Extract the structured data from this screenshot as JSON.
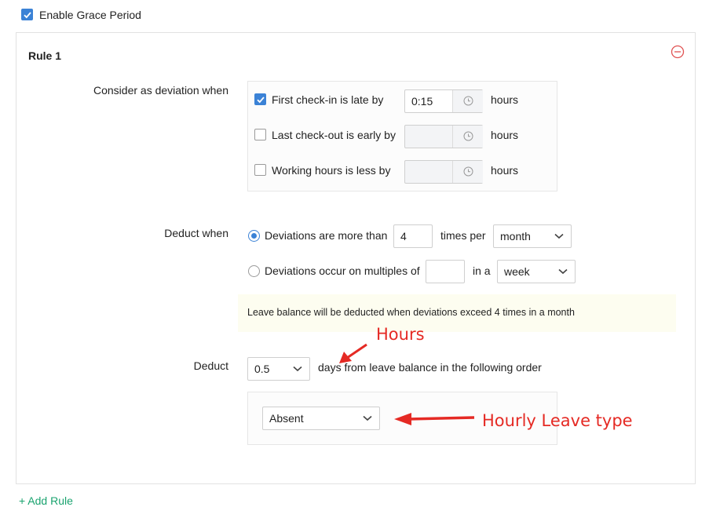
{
  "grace_period": {
    "label": "Enable Grace Period",
    "checked": true
  },
  "rule": {
    "title": "Rule 1",
    "deviation_label": "Consider as deviation when",
    "conditions": [
      {
        "label": "First check-in is late by",
        "checked": true,
        "value": "0:15",
        "unit": "hours"
      },
      {
        "label": "Last check-out is early by",
        "checked": false,
        "value": "",
        "unit": "hours"
      },
      {
        "label": "Working hours is less by",
        "checked": false,
        "value": "",
        "unit": "hours"
      }
    ],
    "deduct_when_label": "Deduct when",
    "option_more": {
      "label": "Deviations are more than",
      "value": "4",
      "mid": "times per",
      "period": "month",
      "selected": true
    },
    "option_multiples": {
      "label": "Deviations occur on multiples of",
      "value": "",
      "mid": "in a",
      "period": "week",
      "selected": false
    },
    "note": "Leave balance will be deducted when deviations exceed 4 times in a month",
    "deduct_label": "Deduct",
    "deduct_value": "0.5",
    "deduct_suffix": "days from leave balance in the following order",
    "leave_type": "Absent"
  },
  "add_rule": "+ Add Rule",
  "annotations": {
    "hours": "Hours",
    "leave_type": "Hourly Leave type"
  },
  "colors": {
    "accent": "#3b82d6",
    "annotation": "#e52a24",
    "remove_icon": "#e05252",
    "note_bg": "#fdfdf0"
  },
  "icons": {
    "remove": "minus-circle-icon",
    "clock": "clock-icon",
    "chevron": "chevron-down-icon"
  }
}
